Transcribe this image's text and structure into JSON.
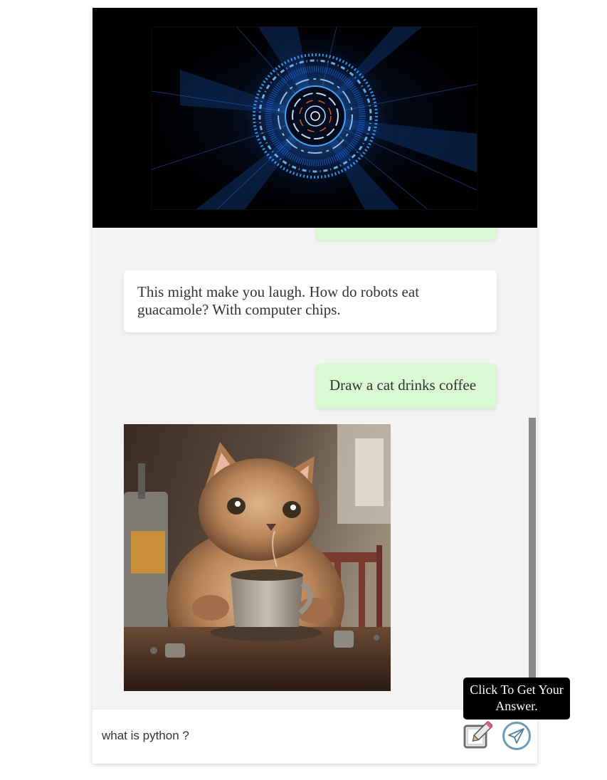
{
  "hero": {
    "icon": "glowing-circuit-ring-animation"
  },
  "messages": [
    {
      "role": "user",
      "text": ""
    },
    {
      "role": "bot",
      "text": "This might make you laugh. How do robots eat guacamole? With computer chips."
    },
    {
      "role": "user",
      "text": "Draw a cat drinks coffee"
    },
    {
      "role": "bot",
      "image": "kitten-drinking-coffee"
    }
  ],
  "input": {
    "value": "what is python ?"
  },
  "tooltip": {
    "text": "Click To Get Your Answer."
  },
  "icons": {
    "edit": "edit-pencil-icon",
    "send": "send-paper-plane-icon"
  },
  "colors": {
    "user_bubble": "#d9f9d2",
    "bot_bubble": "#ffffff",
    "chat_background": "#f3f3f3",
    "hero_glow": "#2f8cff",
    "tooltip_background": "#000000"
  }
}
